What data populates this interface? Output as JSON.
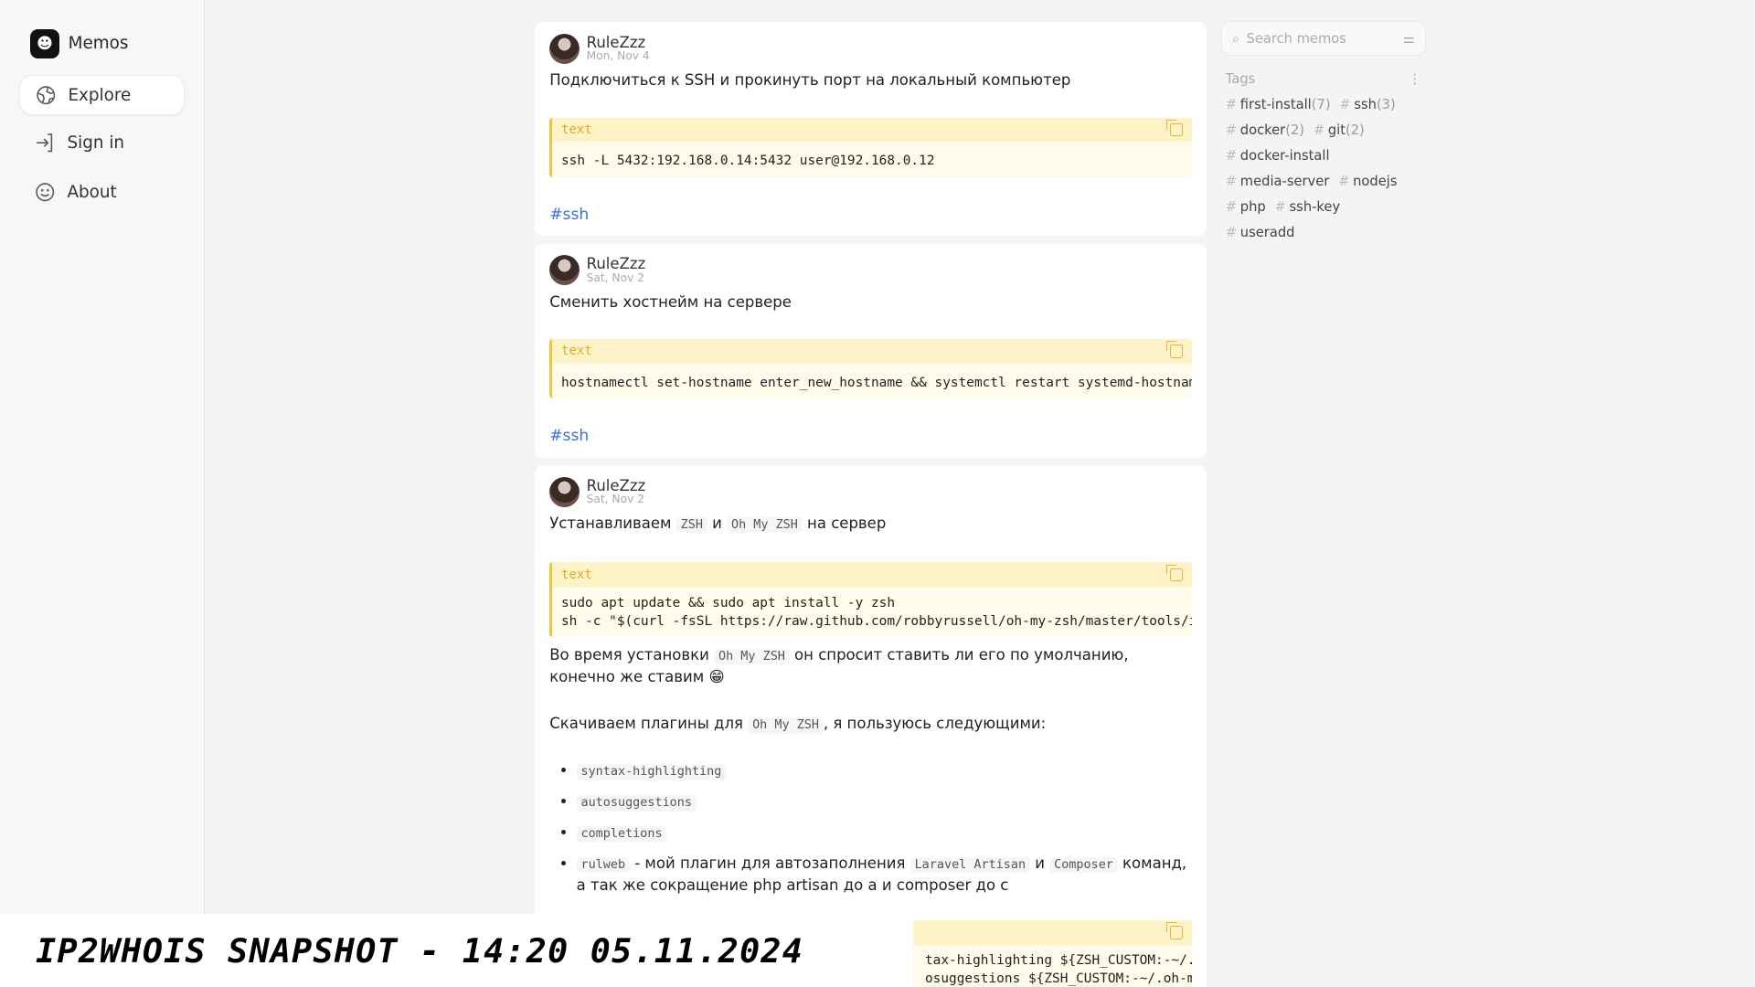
{
  "sidebar": {
    "brand": "Memos",
    "items": [
      {
        "label": "Explore",
        "icon": "globe-icon"
      },
      {
        "label": "Sign in",
        "icon": "sign-in-icon"
      },
      {
        "label": "About",
        "icon": "smile-icon"
      }
    ]
  },
  "memos": [
    {
      "user": "RuleZzz",
      "date": "Mon, Nov 4",
      "title": "Подключиться к SSH и прокинуть порт на локальный компьютер",
      "code_lang": "text",
      "code": "ssh -L 5432:192.168.0.14:5432 user@192.168.0.12",
      "tag": "#ssh"
    },
    {
      "user": "RuleZzz",
      "date": "Sat, Nov 2",
      "title": "Сменить хостнейм на сервере",
      "code_lang": "text",
      "code": "hostnamectl set-hostname enter_new_hostname && systemctl restart systemd-hostnamed",
      "tag": "#ssh"
    },
    {
      "user": "RuleZzz",
      "date": "Sat, Nov 2",
      "intro": [
        "Устанавливаем ",
        "ZSH",
        " и ",
        "Oh My ZSH",
        " на сервер"
      ],
      "code_lang": "text",
      "code": "sudo apt update && sudo apt install -y zsh\nsh -c \"$(curl -fsSL https://raw.github.com/robbyrussell/oh-my-zsh/master/tools/ins",
      "p1": [
        "Во время установки ",
        "Oh My ZSH",
        " он спросит ставить ли его по умолчанию, конечно же ставим 😁"
      ],
      "p2": [
        "Скачиваем плагины для ",
        "Oh My ZSH",
        ", я пользуюсь следующими:"
      ],
      "list": [
        "syntax-highlighting",
        "autosuggestions",
        "completions"
      ],
      "list_last": [
        "rulweb",
        " - мой плагин для автозаполнения ",
        "Laravel Artisan",
        " и ",
        "Composer",
        " команд, а так же сокращение php artisan до a и composer до c"
      ],
      "code2": "tax-highlighting ${ZSH_CUSTOM:-~/.oh\nosuggestions ${ZSH_CUSTOM:-~/.oh-my-"
    }
  ],
  "search": {
    "placeholder": "Search memos"
  },
  "tags_header": "Tags",
  "tags": [
    {
      "name": "first-install",
      "count": "(7)"
    },
    {
      "name": "ssh",
      "count": "(3)"
    },
    {
      "name": "docker",
      "count": "(2)"
    },
    {
      "name": "git",
      "count": "(2)"
    },
    {
      "name": "docker-install",
      "count": ""
    },
    {
      "name": "media-server",
      "count": ""
    },
    {
      "name": "nodejs",
      "count": ""
    },
    {
      "name": "php",
      "count": ""
    },
    {
      "name": "ssh-key",
      "count": ""
    },
    {
      "name": "useradd",
      "count": ""
    }
  ],
  "watermark": "IP2WHOIS SNAPSHOT - 14:20 05.11.2024",
  "colors": {
    "accent_tag": "#3b6fd4",
    "code_border": "#f5c33b",
    "code_bg": "#fffbeb"
  }
}
